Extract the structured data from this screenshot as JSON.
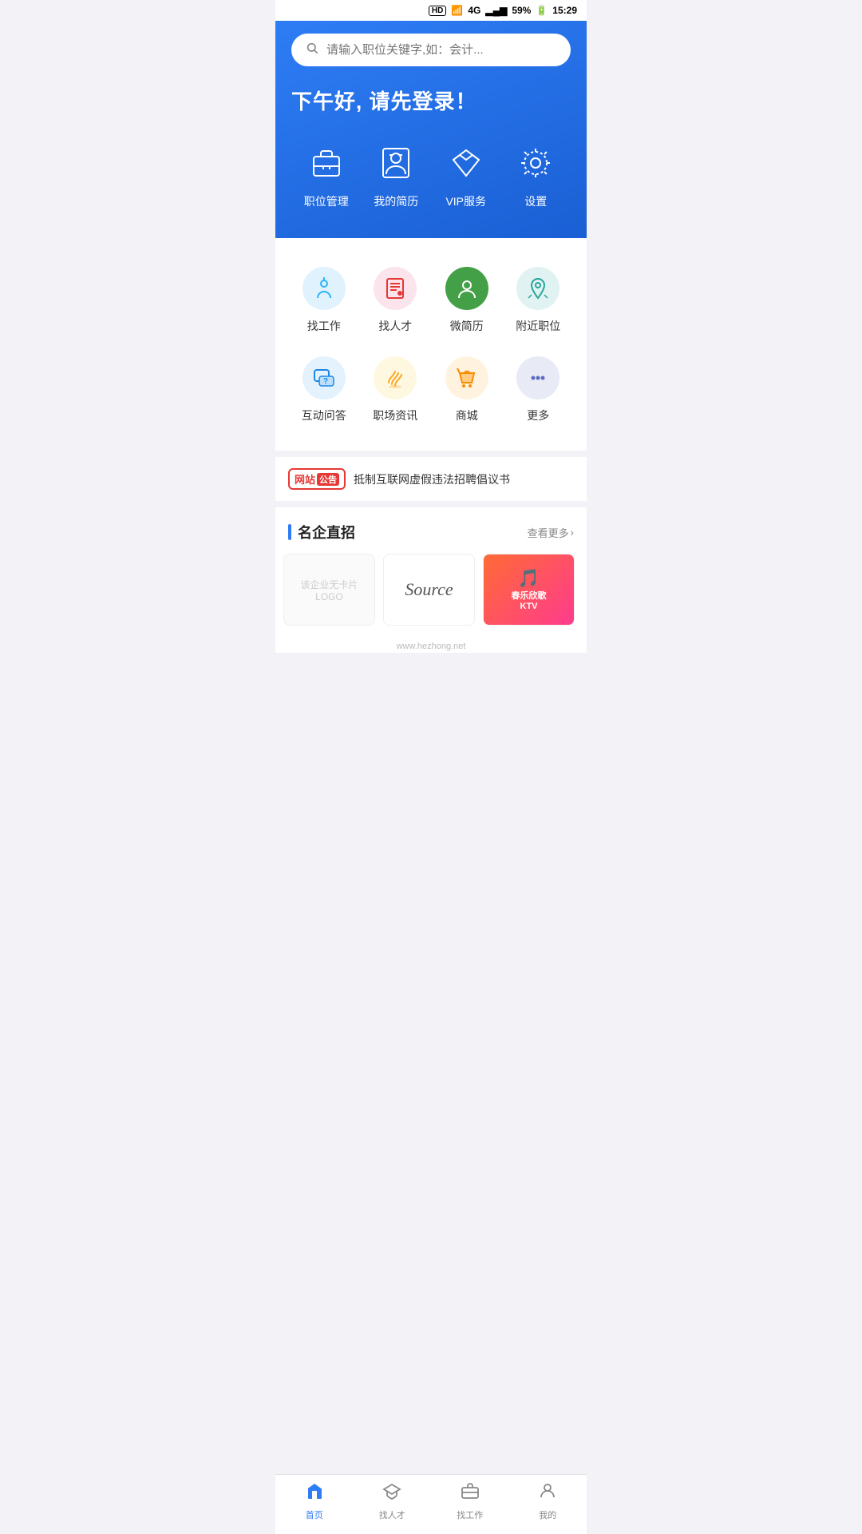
{
  "statusBar": {
    "hd": "HD",
    "signal": "4G",
    "battery": "59%",
    "time": "15:29"
  },
  "search": {
    "placeholder": "请输入职位关键字,如：会计..."
  },
  "greeting": "下午好, 请先登录！",
  "heroIcons": [
    {
      "id": "job-manage",
      "label": "职位管理",
      "icon": "briefcase"
    },
    {
      "id": "resume",
      "label": "我的简历",
      "icon": "person"
    },
    {
      "id": "vip",
      "label": "VIP服务",
      "icon": "diamond"
    },
    {
      "id": "settings",
      "label": "设置",
      "icon": "gear"
    }
  ],
  "services": [
    {
      "id": "find-job",
      "label": "找工作",
      "color": "#e0f2fe",
      "iconColor": "#29b6f6"
    },
    {
      "id": "find-talent",
      "label": "找人才",
      "color": "#fce4ec",
      "iconColor": "#e53935"
    },
    {
      "id": "micro-resume",
      "label": "微简历",
      "color": "#e8f5e9",
      "iconColor": "#43a047"
    },
    {
      "id": "nearby-jobs",
      "label": "附近职位",
      "color": "#e0f2f1",
      "iconColor": "#26a69a"
    },
    {
      "id": "qa",
      "label": "互动问答",
      "color": "#e3f2fd",
      "iconColor": "#1e88e5"
    },
    {
      "id": "workplace-news",
      "label": "职场资讯",
      "color": "#fff8e1",
      "iconColor": "#f9a825"
    },
    {
      "id": "mall",
      "label": "商城",
      "color": "#fff3e0",
      "iconColor": "#fb8c00"
    },
    {
      "id": "more",
      "label": "更多",
      "color": "#e8eaf6",
      "iconColor": "#5c6bc0"
    }
  ],
  "announcement": {
    "badgeText1": "网站",
    "badgeText2": "公告",
    "text": "抵制互联网虚假违法招聘倡议书"
  },
  "sectionTitle": "名企直招",
  "sectionMore": "查看更多",
  "companies": [
    {
      "id": "placeholder1",
      "type": "placeholder",
      "text": "该企业无卡片LOGO"
    },
    {
      "id": "source",
      "type": "source"
    },
    {
      "id": "ktv",
      "type": "ktv",
      "name": "春乐欣歌 KTV"
    }
  ],
  "bottomNav": [
    {
      "id": "home",
      "label": "首页",
      "icon": "home",
      "active": true
    },
    {
      "id": "find-talent-nav",
      "label": "找人才",
      "icon": "graduation",
      "active": false
    },
    {
      "id": "find-job-nav",
      "label": "找工作",
      "icon": "briefcase",
      "active": false
    },
    {
      "id": "mine",
      "label": "我的",
      "icon": "person",
      "active": false
    }
  ],
  "watermark": "www.hezhong.net"
}
